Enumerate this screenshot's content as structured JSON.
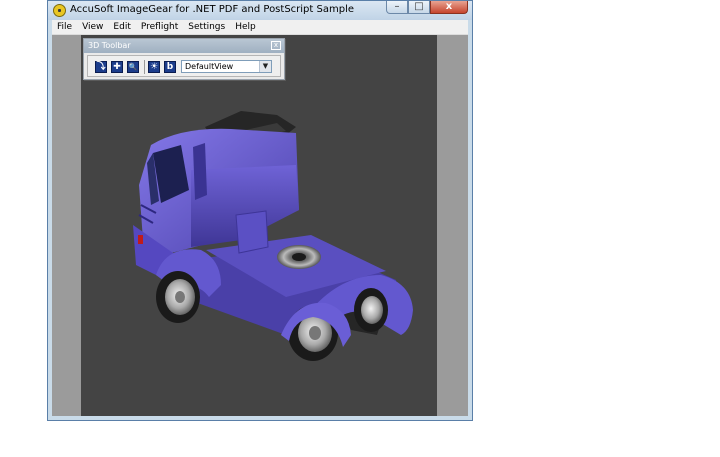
{
  "window": {
    "title": "AccuSoft ImageGear for .NET PDF and PostScript Sample",
    "controls": {
      "minimize": "–",
      "maximize": "□",
      "close": "x"
    }
  },
  "menu": {
    "items": [
      {
        "label": "File"
      },
      {
        "label": "View"
      },
      {
        "label": "Edit"
      },
      {
        "label": "Preflight"
      },
      {
        "label": "Settings"
      },
      {
        "label": "Help"
      }
    ]
  },
  "toolbar3d": {
    "title": "3D Toolbar",
    "close_label": "x",
    "buttons": [
      {
        "icon": "rotate-icon",
        "glyph": "⤵"
      },
      {
        "icon": "pan-icon",
        "glyph": "✚"
      },
      {
        "icon": "zoom-icon",
        "glyph": "🔍"
      },
      {
        "icon": "light-icon",
        "glyph": "☀"
      },
      {
        "icon": "background-icon",
        "glyph": "b"
      }
    ],
    "view_select": {
      "value": "DefaultView",
      "arrow": "▼"
    }
  },
  "scene": {
    "subject": "truck-3d-model",
    "colors": {
      "background": "#444444",
      "body": "#6a5ed0",
      "body_dark": "#4a40a8",
      "spoiler": "#2a2a2a",
      "wheel": "#c8c8c8"
    }
  }
}
